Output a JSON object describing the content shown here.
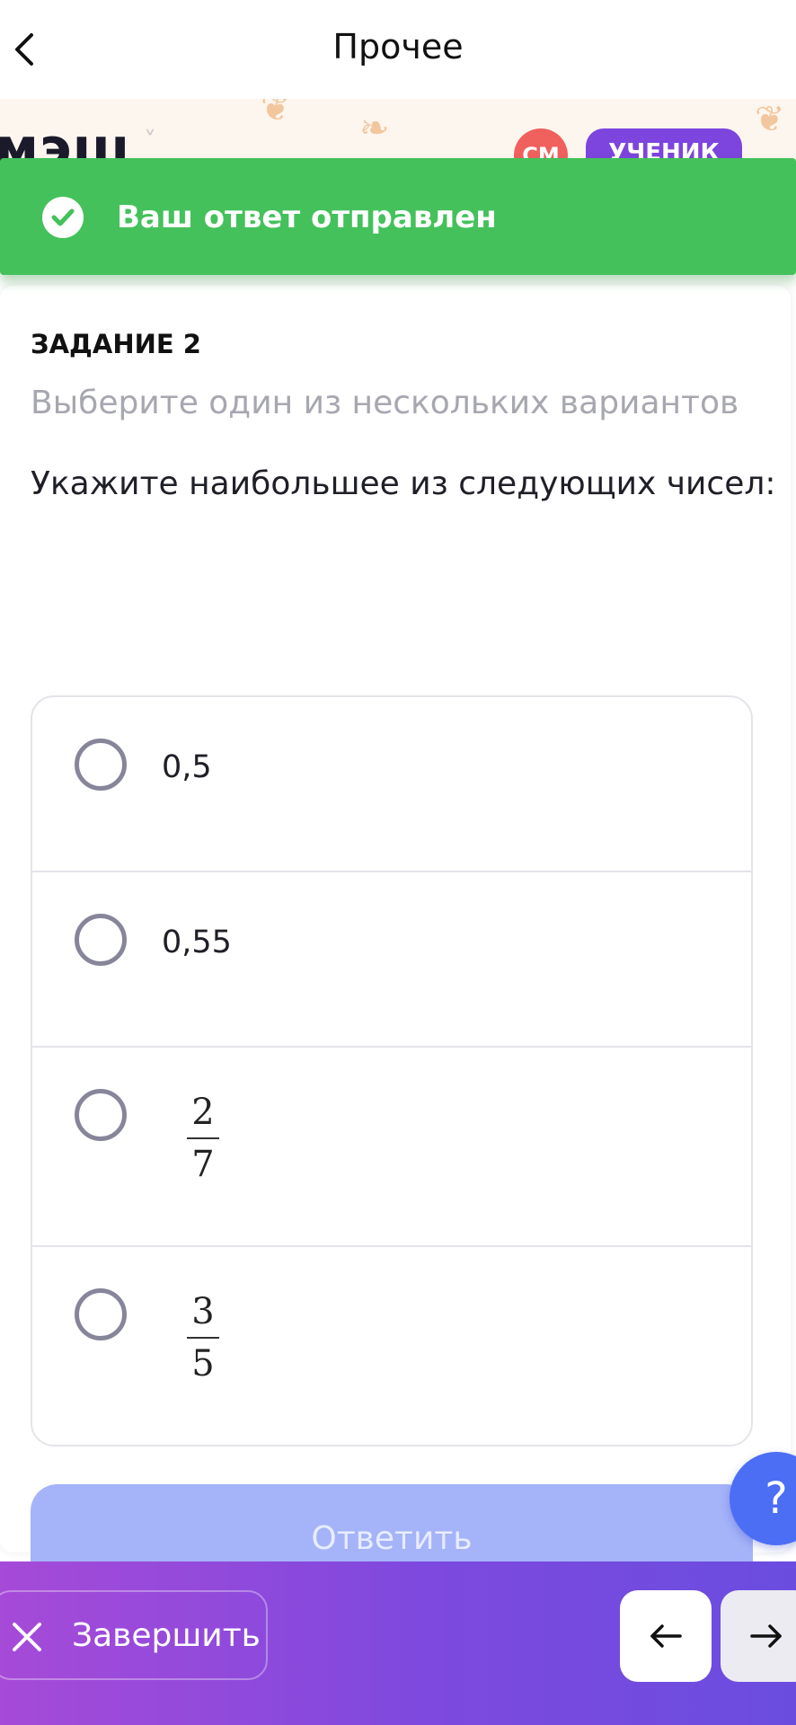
{
  "header": {
    "title": "Прочее",
    "back_icon": "chevron-left-icon"
  },
  "background": {
    "logo_text": "мэш",
    "avatar_initials": "СМ",
    "role_label": "УЧЕНИК"
  },
  "toast": {
    "message": "Ваш ответ отправлен",
    "icon": "check-circle-icon",
    "color": "#44c15b"
  },
  "task": {
    "label": "ЗАДАНИЕ 2",
    "hint": "Выберите один из нескольких вариантов",
    "question": "Укажите наибольшее из следующих чисел:",
    "options": [
      {
        "text": "0,5"
      },
      {
        "text": "0,55"
      },
      {
        "numerator": "2",
        "denominator": "7"
      },
      {
        "numerator": "3",
        "denominator": "5"
      }
    ]
  },
  "answer_button": {
    "label": "Ответить",
    "color": "#a5b3f9"
  },
  "help_button": {
    "label": "?",
    "color": "#4c6ef5"
  },
  "bottom_bar": {
    "finish_label": "Завершить",
    "finish_icon": "close-icon",
    "prev_icon": "arrow-left-icon",
    "next_icon": "arrow-right-icon",
    "gradient": [
      "#a64ad8",
      "#6a4ddf"
    ]
  }
}
